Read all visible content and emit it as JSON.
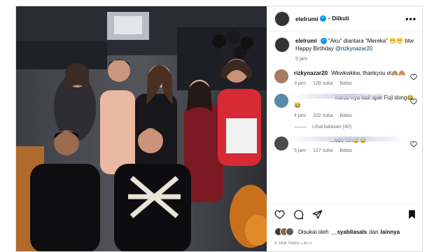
{
  "header": {
    "username": "elelrumi",
    "separator": "•",
    "follow_status": "Diikuti",
    "more": "•••"
  },
  "caption": {
    "username": "elelrumi",
    "text": "\"Aku\" diantara \"Mereka\" 😬😬 btw Happy Birthday",
    "mention": "@rizkynazar20",
    "time": "5 jam"
  },
  "comments": [
    {
      "username": "rizkynazar20",
      "text": "Wkwkwkkw, thankyou el🙈🙈",
      "time": "3 jam",
      "likes": "128 suka",
      "reply": "Balas"
    },
    {
      "username": "",
      "text": "harus nya tadi ajak Fuji dong😂😂",
      "time": "4 jam",
      "likes": "102 suka",
      "reply": "Balas"
    },
    {
      "username": "",
      "text": "...ode nih😂😂",
      "time": "5 jam",
      "likes": "127 suka",
      "reply": "Balas"
    }
  ],
  "view_replies": "Lihat balasan (40)",
  "likes_line": {
    "prefix": "Disukai oleh",
    "user": "__syabilasals",
    "joiner": "dan",
    "rest": "lainnya"
  },
  "time_ago": "5 JAM YANG LALU",
  "colors": {
    "verified": "#0095f6",
    "mention": "#00376b",
    "muted": "#737373"
  }
}
